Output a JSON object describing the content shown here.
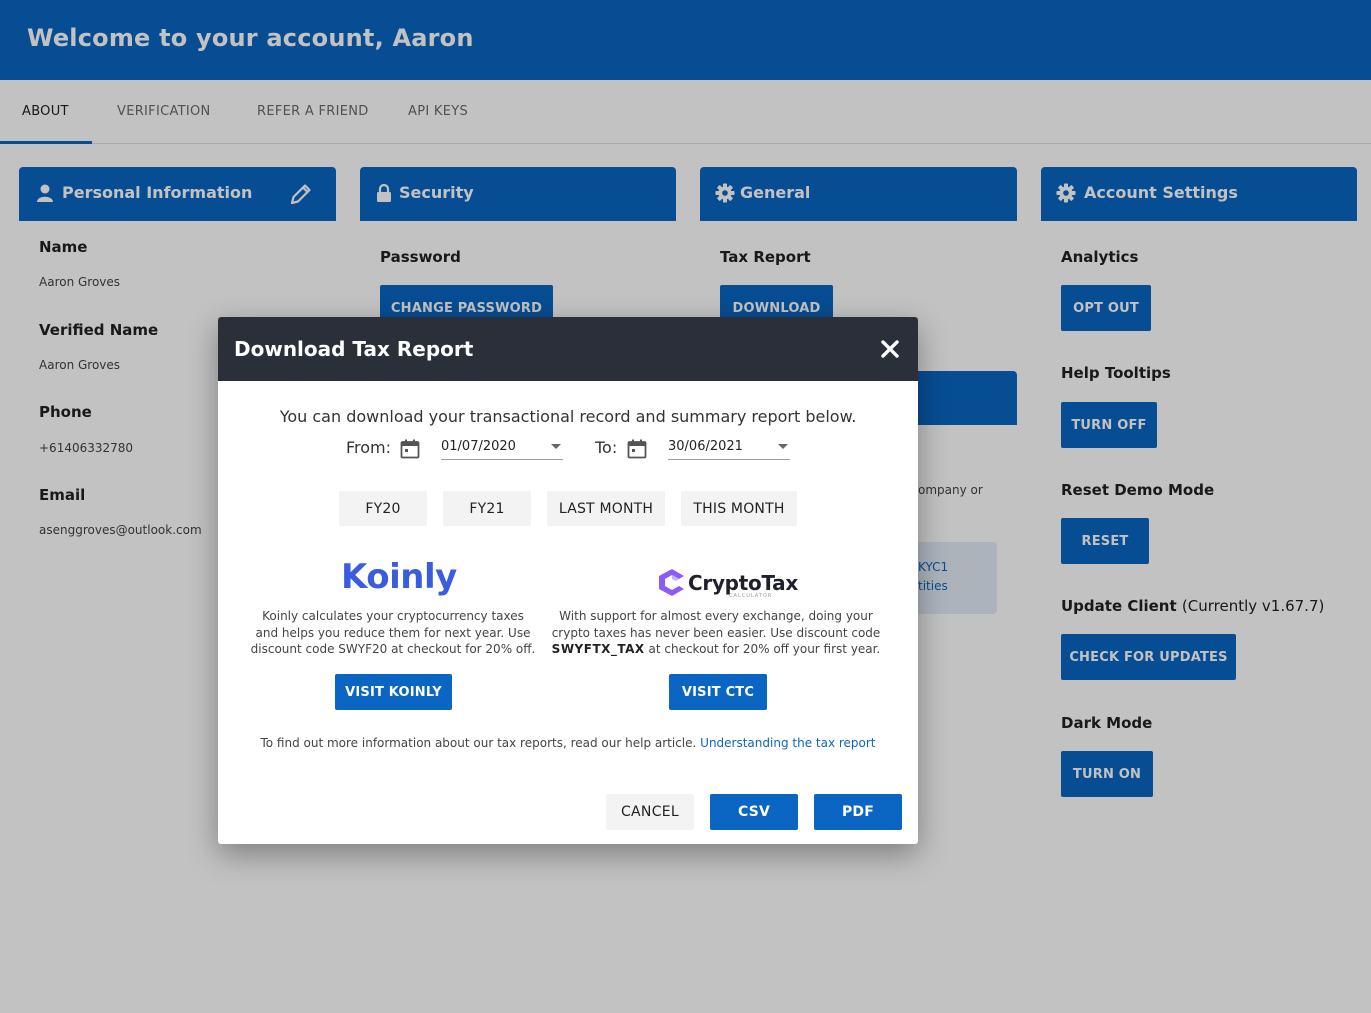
{
  "header": {
    "title": "Welcome to your account, Aaron"
  },
  "tabs": [
    {
      "label": "ABOUT"
    },
    {
      "label": "VERIFICATION"
    },
    {
      "label": "REFER A FRIEND"
    },
    {
      "label": "API KEYS"
    }
  ],
  "personal": {
    "title": "Personal Information",
    "name_label": "Name",
    "name_value": "Aaron Groves",
    "verified_label": "Verified Name",
    "verified_value": "Aaron Groves",
    "phone_label": "Phone",
    "phone_value": "+61406332780",
    "email_label": "Email",
    "email_value": "asenggroves@outlook.com"
  },
  "security": {
    "title": "Security",
    "password_label": "Password",
    "change_password": "CHANGE PASSWORD"
  },
  "general": {
    "title": "General",
    "tax_label": "Tax Report",
    "download": "DOWNLOAD"
  },
  "hidden_card": {
    "text_fragment": "ompany or",
    "link_line1": "KYC1",
    "link_line2": "tities"
  },
  "settings": {
    "title": "Account Settings",
    "analytics_label": "Analytics",
    "opt_out": "OPT OUT",
    "tooltips_label": "Help Tooltips",
    "turn_off": "TURN OFF",
    "demo_label": "Reset Demo Mode",
    "reset": "RESET",
    "update_label": "Update Client",
    "update_version": "(Currently v1.67.7)",
    "check_updates": "CHECK FOR UPDATES",
    "dark_label": "Dark Mode",
    "turn_on": "TURN ON"
  },
  "modal": {
    "title": "Download Tax Report",
    "intro": "You can download your transactional record and summary report below.",
    "from_label": "From:",
    "from_value": "01/07/2020",
    "to_label": "To:",
    "to_value": "30/06/2021",
    "presets": [
      "FY20",
      "FY21",
      "LAST MONTH",
      "THIS MONTH"
    ],
    "koinly": {
      "logo": "Koinly",
      "desc_line1": "Koinly calculates your cryptocurrency taxes",
      "desc_line2": "and helps you reduce them for next year. Use",
      "desc_line3": "discount code SWYF20 at checkout for 20% off.",
      "button": "VISIT KOINLY"
    },
    "ctc": {
      "logo": "CryptoTax",
      "logo_sub": "CALCULATOR",
      "desc_line1": "With support for almost every exchange, doing your",
      "desc_line2": "crypto taxes has never been easier. Use discount code",
      "code": "SWYFTX_TAX",
      "desc_line3": " at checkout for 20% off your first year.",
      "button": "VISIT CTC"
    },
    "footer_text": "To find out more information about our tax reports, read our help article. ",
    "footer_link": "Understanding the tax report",
    "cancel": "CANCEL",
    "csv": "CSV",
    "pdf": "PDF"
  },
  "colors": {
    "primary": "#0a66c2",
    "modal_header": "#2b2f3a",
    "koinly": "#3c5ce0",
    "ctc_purple": "#8b5cf6"
  }
}
